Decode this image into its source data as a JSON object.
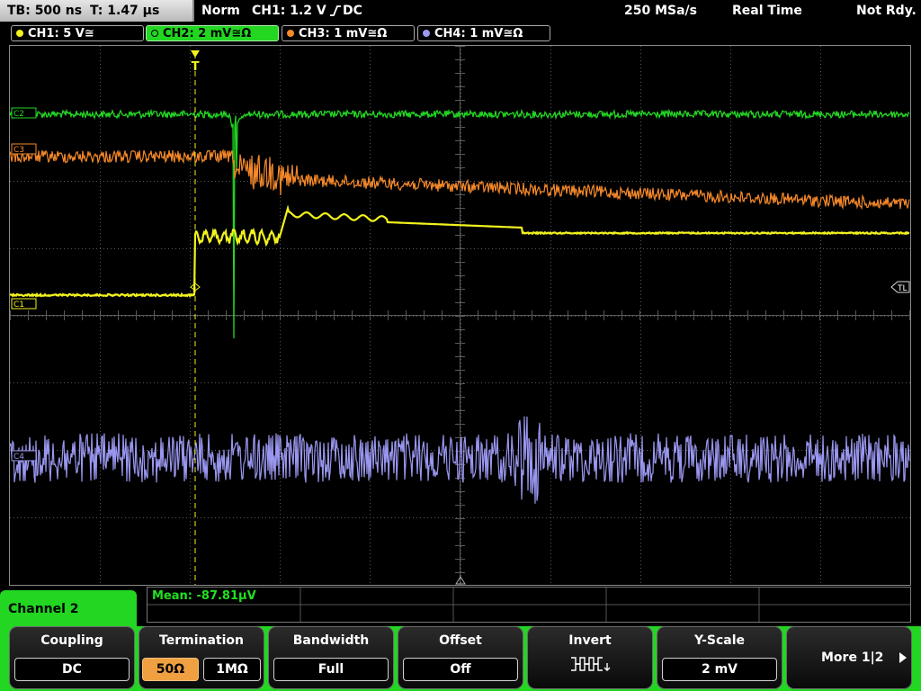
{
  "status_bar": {
    "timebase": "TB: 500 ns",
    "trigger_time": "T: 1.47 µs",
    "trigger_mode": "Norm",
    "trigger_source": "CH1: 1.2 V",
    "trigger_slope_coupling": "DC",
    "sample_rate": "250 MSa/s",
    "acquisition_mode": "Real Time",
    "trigger_status": "Not Rdy."
  },
  "channel_tabs": [
    {
      "label": "CH1: 5 V≅",
      "color": "#f2f21e",
      "active": false
    },
    {
      "label": "CH2: 2 mV≅Ω",
      "color": "#22d622",
      "active": true
    },
    {
      "label": "CH3: 1 mV≅Ω",
      "color": "#f5892a",
      "active": false
    },
    {
      "label": "CH4: 1 mV≅Ω",
      "color": "#9a97f0",
      "active": false
    }
  ],
  "plot": {
    "trace_labels": {
      "ch1": "C1",
      "ch2": "C2",
      "ch3": "C3",
      "ch4": "C4"
    },
    "trigger_level_marker": "TL",
    "trigger_position_marker": "T",
    "colors": {
      "ch1": "#f2f21e",
      "ch2": "#22d622",
      "ch3": "#f5892a",
      "ch4": "#9a97f0",
      "grid": "#5a5a5a"
    }
  },
  "measurement": {
    "label": "Mean: -87.81µV"
  },
  "menu": {
    "title": "Channel 2",
    "keys": {
      "coupling": {
        "title": "Coupling",
        "value": "DC"
      },
      "termination": {
        "title": "Termination",
        "option_a": "50Ω",
        "option_b": "1MΩ"
      },
      "bandwidth": {
        "title": "Bandwidth",
        "value": "Full"
      },
      "offset": {
        "title": "Offset",
        "value": "Off"
      },
      "invert": {
        "title": "Invert",
        "icon": "invert-waveform-icon"
      },
      "y_scale": {
        "title": "Y-Scale",
        "value": "2 mV"
      },
      "more": {
        "label": "More 1|2",
        "icon": "right-arrow-icon"
      }
    }
  }
}
